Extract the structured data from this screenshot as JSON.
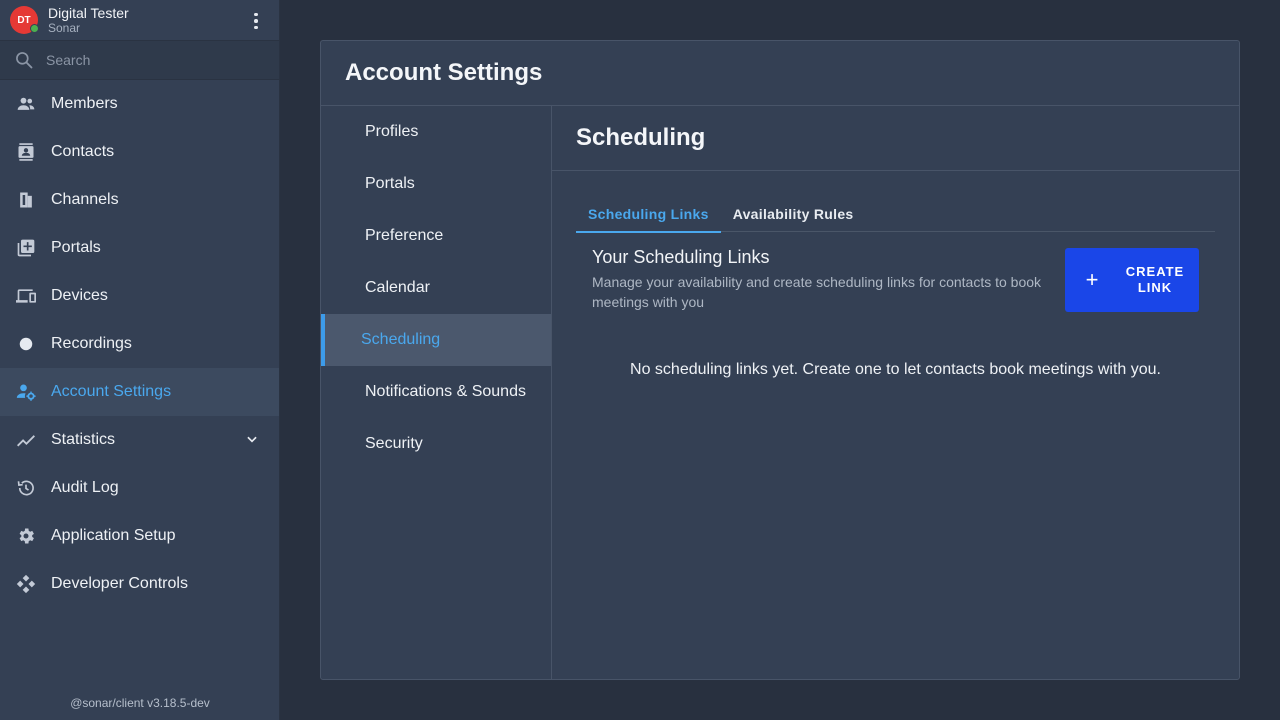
{
  "user": {
    "initials": "DT",
    "name": "Digital Tester",
    "org": "Sonar",
    "status_color": "#4caf50"
  },
  "search": {
    "placeholder": "Search"
  },
  "sidebar": {
    "items": [
      {
        "label": "Members",
        "icon": "members-icon"
      },
      {
        "label": "Contacts",
        "icon": "contacts-icon"
      },
      {
        "label": "Channels",
        "icon": "channels-icon"
      },
      {
        "label": "Portals",
        "icon": "portals-icon"
      },
      {
        "label": "Devices",
        "icon": "devices-icon"
      },
      {
        "label": "Recordings",
        "icon": "recordings-icon"
      },
      {
        "label": "Account Settings",
        "icon": "account-settings-icon",
        "active": true
      },
      {
        "label": "Statistics",
        "icon": "statistics-icon",
        "expandable": true
      },
      {
        "label": "Audit Log",
        "icon": "audit-log-icon"
      },
      {
        "label": "Application Setup",
        "icon": "gear-icon"
      },
      {
        "label": "Developer Controls",
        "icon": "developer-controls-icon"
      }
    ],
    "version": "@sonar/client v3.18.5-dev"
  },
  "page": {
    "title": "Account Settings",
    "subnav": [
      {
        "label": "Profiles"
      },
      {
        "label": "Portals"
      },
      {
        "label": "Preference"
      },
      {
        "label": "Calendar"
      },
      {
        "label": "Scheduling",
        "active": true
      },
      {
        "label": "Notifications & Sounds"
      },
      {
        "label": "Security"
      }
    ]
  },
  "scheduling": {
    "title": "Scheduling",
    "tabs": [
      {
        "label": "Scheduling Links",
        "active": true
      },
      {
        "label": "Availability Rules"
      }
    ],
    "links_title": "Your Scheduling Links",
    "links_description": "Manage your availability and create scheduling links for contacts to book meetings with you",
    "create_button": {
      "icon": "plus-icon",
      "line1": "CREATE",
      "line2": "LINK"
    },
    "empty_message": "No scheduling links yet. Create one to let contacts book meetings with you."
  },
  "colors": {
    "accent": "#4aa8ee",
    "button": "#1a46e8",
    "avatar": "#e53935"
  }
}
